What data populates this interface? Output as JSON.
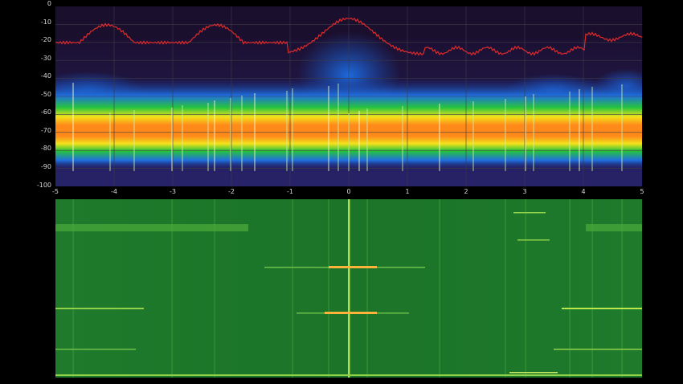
{
  "spectrum": {
    "y_ticks": [
      "0",
      "-10",
      "-20",
      "-30",
      "-40",
      "-50",
      "-60",
      "-70",
      "-80",
      "-90",
      "-100"
    ],
    "x_ticks": [
      "-5",
      "-4",
      "-3",
      "-2",
      "-1",
      "0",
      "1",
      "2",
      "3",
      "4",
      "5"
    ],
    "colors": {
      "background": "#1b0f2e",
      "grid": "#3c3c46",
      "peak_trace": "#e02a2a",
      "band_core": "#ff8a1a",
      "band_mid": "#f3e21a",
      "band_outer": "#27c43c",
      "band_edge": "#1f6fe0"
    }
  },
  "waterfall": {
    "colors": {
      "background": "#1e7a2a",
      "bright_line": "#b8e850",
      "hot_spot": "#ffb23a"
    }
  }
}
